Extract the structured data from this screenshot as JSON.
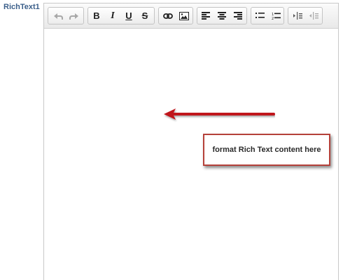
{
  "field": {
    "label": "RichText1"
  },
  "toolbar": {
    "undo_icon": "undo-icon",
    "redo_icon": "redo-icon",
    "bold_label": "B",
    "italic_label": "I",
    "underline_label": "U",
    "strike_label": "S",
    "link_icon": "link-icon",
    "image_icon": "image-icon",
    "align_left_icon": "align-left-icon",
    "align_center_icon": "align-center-icon",
    "align_right_icon": "align-right-icon",
    "bullet_list_icon": "bullet-list-icon",
    "numbered_list_icon": "numbered-list-icon",
    "indent_icon": "indent-icon",
    "outdent_icon": "outdent-icon"
  },
  "annotation": {
    "text": "format Rich Text content here",
    "color": "#b5413a",
    "arrow_color": "#c0141c"
  }
}
